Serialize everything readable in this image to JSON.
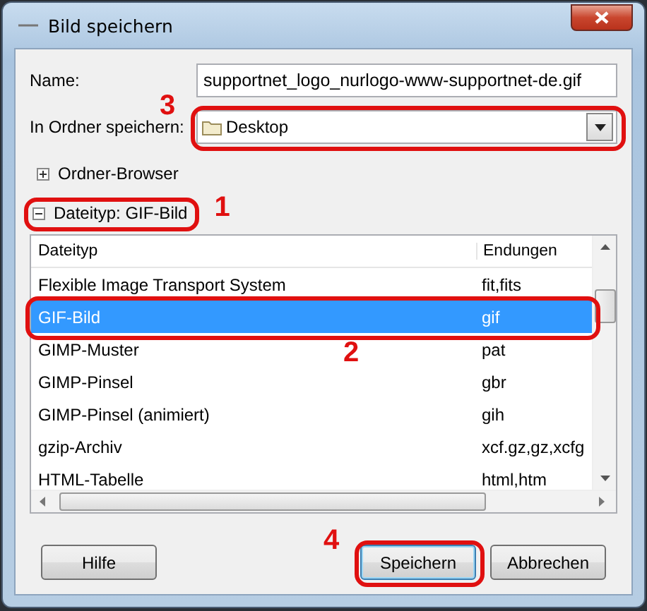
{
  "window": {
    "title": "Bild speichern"
  },
  "name_field": {
    "label": "Name:",
    "value": "supportnet_logo_nurlogo-www-supportnet-de.gif"
  },
  "folder_field": {
    "label": "In Ordner speichern:",
    "value": "Desktop",
    "annotation": "3"
  },
  "folder_browser": {
    "label": "Ordner-Browser",
    "expanded": false
  },
  "file_type": {
    "label": "Dateityp: GIF-Bild",
    "expanded": true,
    "annotation": "1"
  },
  "table": {
    "columns": [
      "Dateityp",
      "Endungen"
    ],
    "rows": [
      {
        "cells": [
          "Flexible Image Transport System",
          "fit,fits"
        ],
        "selected": false
      },
      {
        "cells": [
          "GIF-Bild",
          "gif"
        ],
        "selected": true,
        "annotation": "2"
      },
      {
        "cells": [
          "GIMP-Muster",
          "pat"
        ],
        "selected": false
      },
      {
        "cells": [
          "GIMP-Pinsel",
          "gbr"
        ],
        "selected": false
      },
      {
        "cells": [
          "GIMP-Pinsel (animiert)",
          "gih"
        ],
        "selected": false
      },
      {
        "cells": [
          "gzip-Archiv",
          "xcf.gz,gz,xcfg"
        ],
        "selected": false
      },
      {
        "cells": [
          "HTML-Tabelle",
          "html,htm"
        ],
        "selected": false
      }
    ]
  },
  "buttons": [
    {
      "label": "Hilfe",
      "default": false
    },
    {
      "label": "Speichern",
      "default": true,
      "annotation": "4"
    },
    {
      "label": "Abbrechen",
      "default": false
    }
  ]
}
